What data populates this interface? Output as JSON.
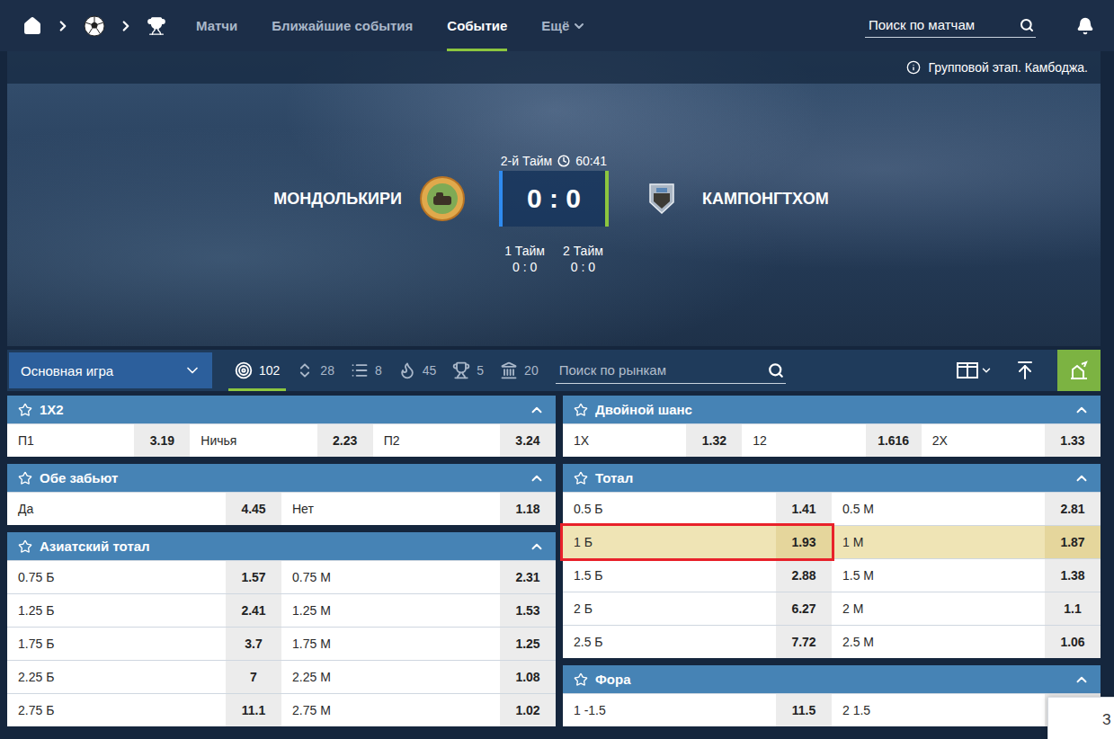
{
  "nav": {
    "links": [
      {
        "label": "Матчи",
        "selected": false,
        "dropdown": false
      },
      {
        "label": "Ближайшие события",
        "selected": false,
        "dropdown": false
      },
      {
        "label": "Событие",
        "selected": true,
        "dropdown": false
      },
      {
        "label": "Ещё",
        "selected": false,
        "dropdown": true
      }
    ],
    "search": {
      "placeholder": "Поиск по матчам"
    }
  },
  "event": {
    "info": "Групповой этап. Камбоджа.",
    "period": "2-й Тайм",
    "time": "60:41",
    "home": "МОНДОЛЬКИРИ",
    "away": "КАМПОНГТХОМ",
    "score": "0 : 0",
    "halves": [
      {
        "label": "1 Тайм",
        "score": "0 : 0"
      },
      {
        "label": "2 Тайм",
        "score": "0 : 0"
      }
    ]
  },
  "toolbar": {
    "dropdown": "Основная игра",
    "tabs": [
      {
        "kind": "all",
        "count": "102",
        "selected": true
      },
      {
        "kind": "totals",
        "count": "28",
        "selected": false
      },
      {
        "kind": "stats",
        "count": "8",
        "selected": false
      },
      {
        "kind": "hot",
        "count": "45",
        "selected": false
      },
      {
        "kind": "specials",
        "count": "5",
        "selected": false
      },
      {
        "kind": "periods",
        "count": "20",
        "selected": false
      }
    ],
    "search": {
      "placeholder": "Поиск по рынкам"
    }
  },
  "markets": {
    "left": [
      {
        "title": "1X2",
        "expanded": true,
        "rows": [
          {
            "highlighted": false,
            "outcomes": [
              {
                "label": "П1",
                "odd": "3.19",
                "selected": false
              },
              {
                "label": "Ничья",
                "odd": "2.23",
                "selected": false
              },
              {
                "label": "П2",
                "odd": "3.24",
                "selected": false
              }
            ]
          }
        ]
      },
      {
        "title": "Обе забьют",
        "expanded": true,
        "rows": [
          {
            "highlighted": false,
            "outcomes": [
              {
                "label": "Да",
                "odd": "4.45",
                "selected": false
              },
              {
                "label": "Нет",
                "odd": "1.18",
                "selected": false
              }
            ]
          }
        ]
      },
      {
        "title": "Азиатский тотал",
        "expanded": true,
        "rows": [
          {
            "highlighted": false,
            "outcomes": [
              {
                "label": "0.75 Б",
                "odd": "1.57",
                "selected": false
              },
              {
                "label": "0.75 М",
                "odd": "2.31",
                "selected": false
              }
            ]
          },
          {
            "highlighted": false,
            "outcomes": [
              {
                "label": "1.25 Б",
                "odd": "2.41",
                "selected": false
              },
              {
                "label": "1.25 М",
                "odd": "1.53",
                "selected": false
              }
            ]
          },
          {
            "highlighted": false,
            "outcomes": [
              {
                "label": "1.75 Б",
                "odd": "3.7",
                "selected": false
              },
              {
                "label": "1.75 М",
                "odd": "1.25",
                "selected": false
              }
            ]
          },
          {
            "highlighted": false,
            "outcomes": [
              {
                "label": "2.25 Б",
                "odd": "7",
                "selected": false
              },
              {
                "label": "2.25 М",
                "odd": "1.08",
                "selected": false
              }
            ]
          },
          {
            "highlighted": false,
            "outcomes": [
              {
                "label": "2.75 Б",
                "odd": "11.1",
                "selected": false
              },
              {
                "label": "2.75 М",
                "odd": "1.02",
                "selected": false
              }
            ]
          }
        ]
      }
    ],
    "right": [
      {
        "title": "Двойной шанс",
        "expanded": true,
        "rows": [
          {
            "highlighted": false,
            "outcomes": [
              {
                "label": "1X",
                "odd": "1.32",
                "selected": false
              },
              {
                "label": "12",
                "odd": "1.616",
                "selected": false
              },
              {
                "label": "2X",
                "odd": "1.33",
                "selected": false
              }
            ]
          }
        ]
      },
      {
        "title": "Тотал",
        "expanded": true,
        "rows": [
          {
            "highlighted": false,
            "outcomes": [
              {
                "label": "0.5 Б",
                "odd": "1.41",
                "selected": false
              },
              {
                "label": "0.5 М",
                "odd": "2.81",
                "selected": false
              }
            ]
          },
          {
            "highlighted": true,
            "outcomes": [
              {
                "label": "1 Б",
                "odd": "1.93",
                "selected": true
              },
              {
                "label": "1 М",
                "odd": "1.87",
                "selected": false
              }
            ]
          },
          {
            "highlighted": false,
            "outcomes": [
              {
                "label": "1.5 Б",
                "odd": "2.88",
                "selected": false
              },
              {
                "label": "1.5 М",
                "odd": "1.38",
                "selected": false
              }
            ]
          },
          {
            "highlighted": false,
            "outcomes": [
              {
                "label": "2 Б",
                "odd": "6.27",
                "selected": false
              },
              {
                "label": "2 М",
                "odd": "1.1",
                "selected": false
              }
            ]
          },
          {
            "highlighted": false,
            "outcomes": [
              {
                "label": "2.5 Б",
                "odd": "7.72",
                "selected": false
              },
              {
                "label": "2.5 М",
                "odd": "1.06",
                "selected": false
              }
            ]
          }
        ]
      },
      {
        "title": "Фора",
        "expanded": true,
        "rows": [
          {
            "highlighted": false,
            "outcomes": [
              {
                "label": "1 -1.5",
                "odd": "11.5",
                "selected": false
              },
              {
                "label": "2 1.5",
                "odd": "",
                "selected": false
              }
            ]
          }
        ]
      }
    ]
  },
  "chat_widget": {
    "text": "З"
  }
}
